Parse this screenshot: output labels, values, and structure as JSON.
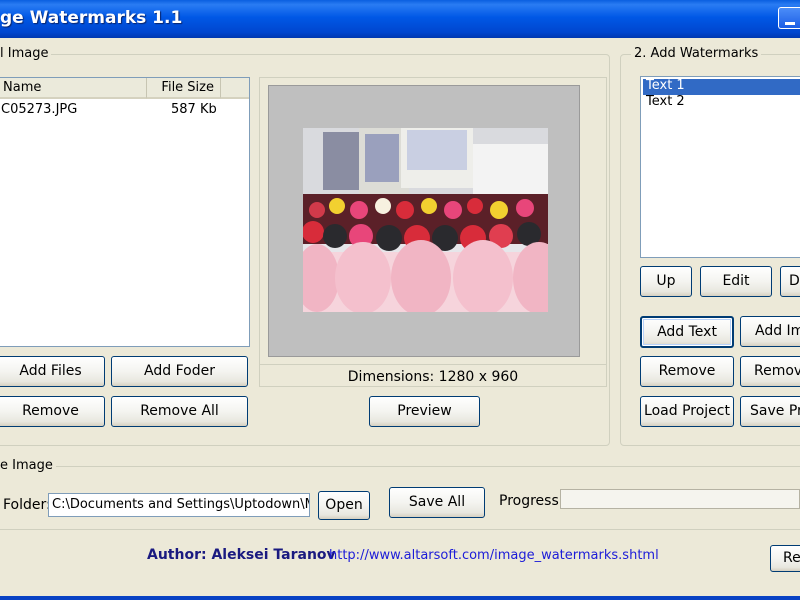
{
  "window": {
    "title": "ge Watermarks 1.1"
  },
  "source": {
    "legend": "l Image",
    "columns": [
      "Name",
      "File Size"
    ],
    "rows": [
      {
        "name": "C05273.JPG",
        "size": "587 Kb"
      }
    ],
    "buttons": {
      "add_files": "Add Files",
      "add_folder": "Add Foder",
      "remove": "Remove",
      "remove_all": "Remove All"
    }
  },
  "preview": {
    "dimensions": "Dimensions: 1280 x 960",
    "preview_button": "Preview"
  },
  "watermarks": {
    "legend": "2. Add Watermarks",
    "items": [
      "Text 1",
      "Text 2"
    ],
    "buttons": {
      "up": "Up",
      "edit": "Edit",
      "delete": "D",
      "add_text": "Add Text",
      "add_image": "Add Ima",
      "remove": "Remove",
      "remove2": "Remove",
      "load_project": "Load Project",
      "save_project": "Save Pro"
    }
  },
  "output": {
    "legend": "e Image",
    "folder_label": "Folder:",
    "folder_value": "C:\\Documents and Settings\\Uptodown\\Mi",
    "open_button": "Open",
    "save_all_button": "Save All",
    "progress_label": "Progress:"
  },
  "footer": {
    "author": "Author: Aleksei Taranov",
    "url": "http://www.altarsoft.com/image_watermarks.shtml",
    "right_button": "Re"
  },
  "colors": {
    "title_bar": "#0058e6",
    "selection": "#316ac5",
    "author": "#1a1a80",
    "link": "#1c1cd8"
  }
}
